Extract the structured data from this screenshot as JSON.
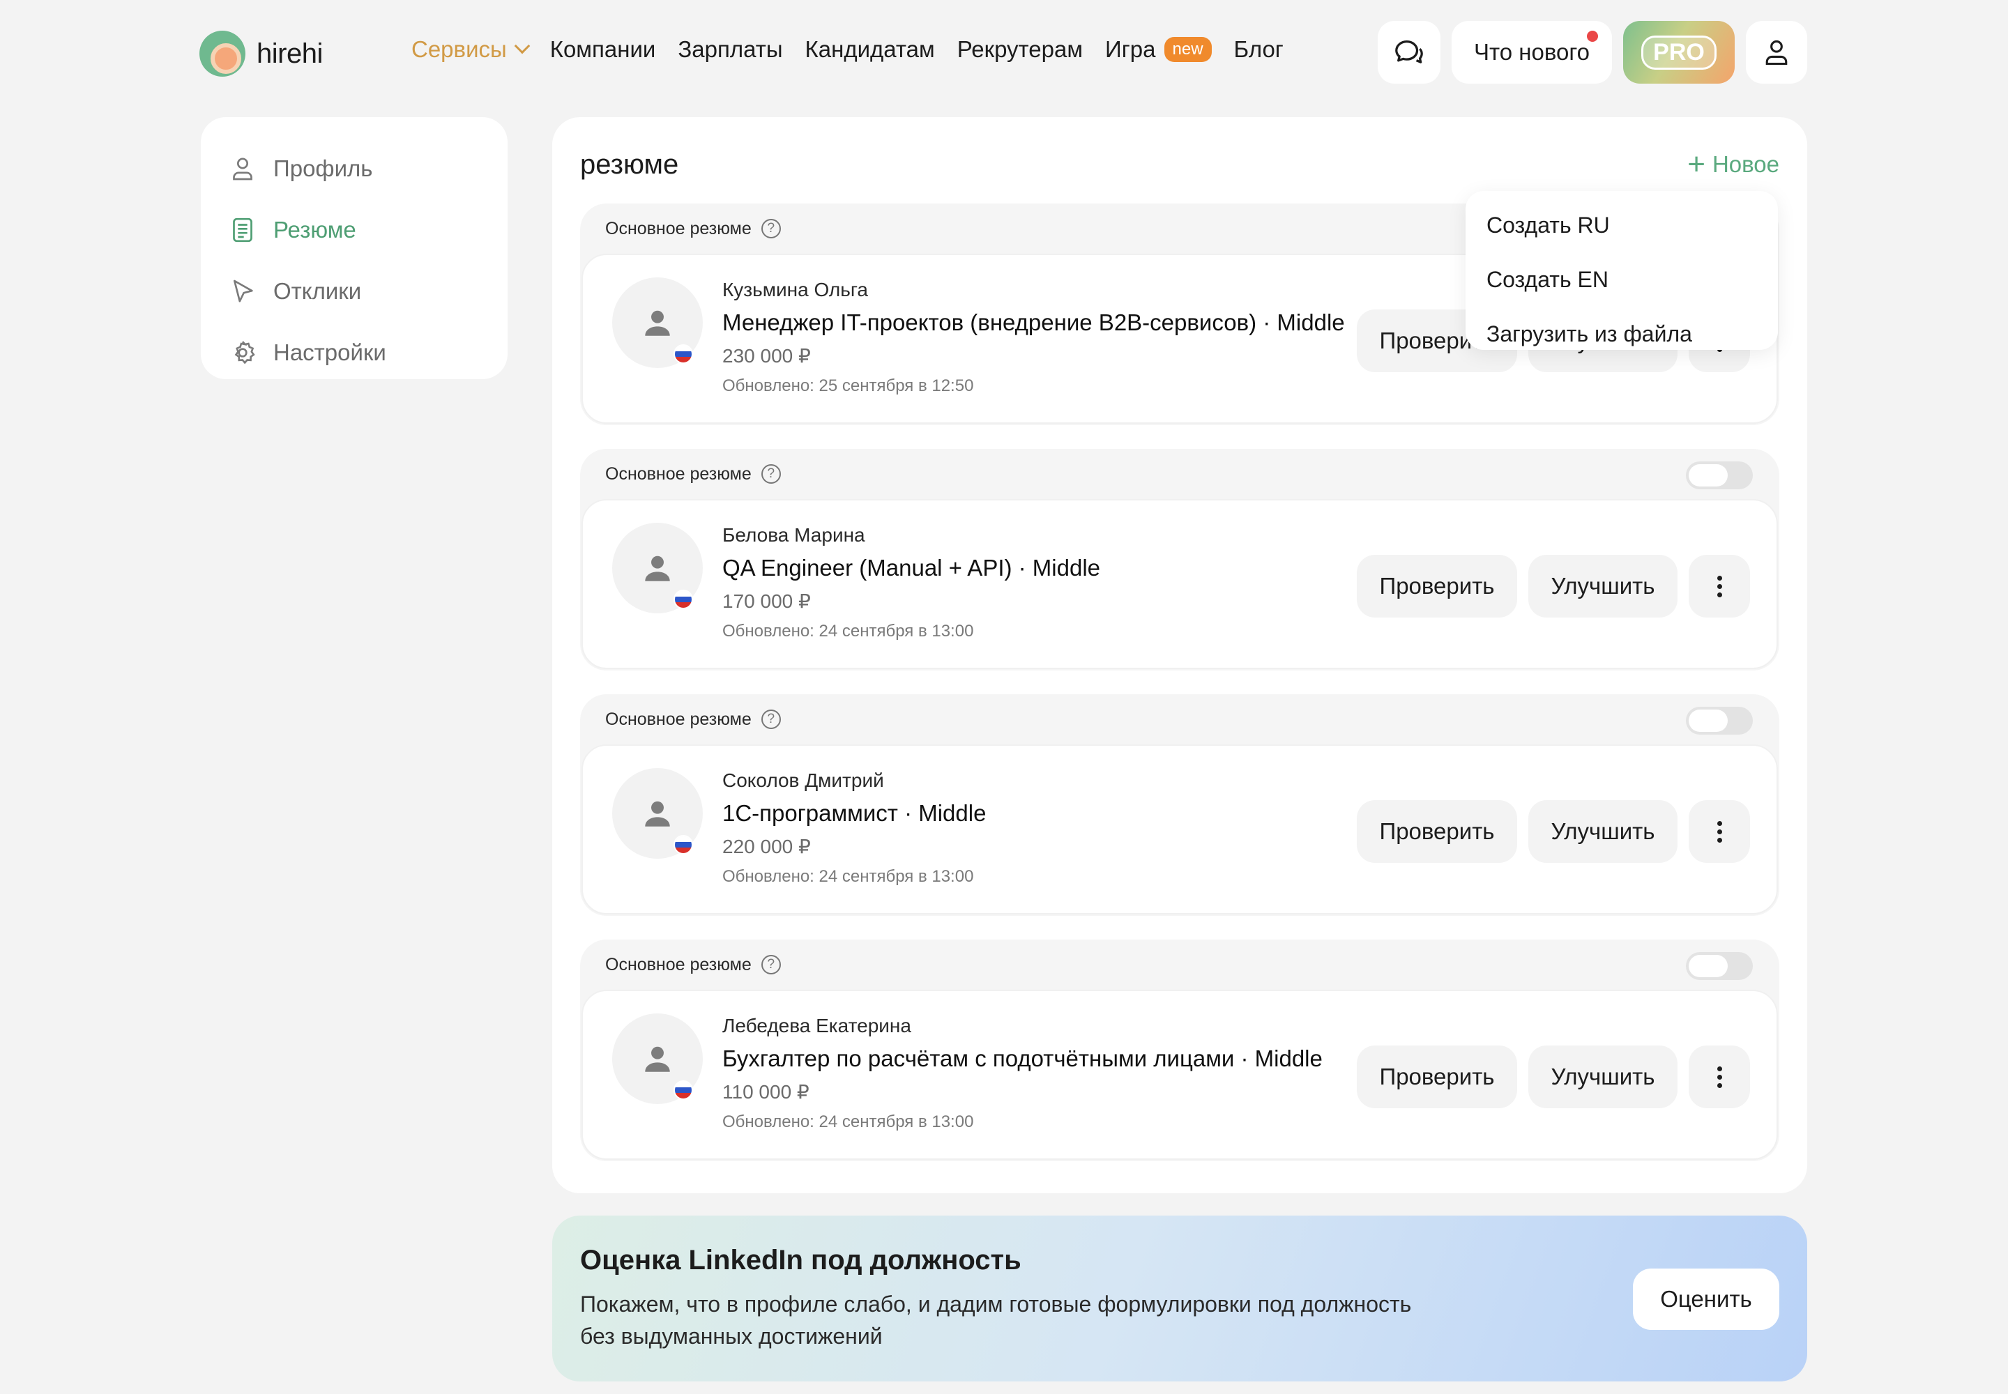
{
  "header": {
    "logo_text": "hirehi",
    "nav": [
      {
        "label": "Сервисы"
      },
      {
        "label": "Компании"
      },
      {
        "label": "Зарплаты"
      },
      {
        "label": "Кандидатам"
      },
      {
        "label": "Рекрутерам"
      },
      {
        "label": "Игра",
        "badge": "new"
      },
      {
        "label": "Блог"
      }
    ],
    "news_label": "Что нового",
    "pro_label": "PRO"
  },
  "sidebar": {
    "items": [
      {
        "label": "Профиль",
        "icon": "user-icon",
        "active": false
      },
      {
        "label": "Резюме",
        "icon": "document-icon",
        "active": true
      },
      {
        "label": "Отклики",
        "icon": "cursor-icon",
        "active": false
      },
      {
        "label": "Настройки",
        "icon": "gear-icon",
        "active": false
      }
    ]
  },
  "main": {
    "title": "резюме",
    "new_label": "Новое",
    "dropdown": [
      "Создать RU",
      "Создать EN",
      "Загрузить из файла"
    ],
    "resumes": [
      {
        "head_label": "Основное резюме",
        "name": "Кузьмина Ольга",
        "job": "Менеджер IT-проектов (внедрение B2B-сервисов) · Middle",
        "salary": "230 000 ₽",
        "updated": "Обновлено: 25 сентября в 12:50",
        "check_label": "Проверить",
        "improve_label": "Улучшить"
      },
      {
        "head_label": "Основное резюме",
        "name": "Белова Марина",
        "job": "QA Engineer (Manual + API) · Middle",
        "salary": "170 000 ₽",
        "updated": "Обновлено: 24 сентября в 13:00",
        "check_label": "Проверить",
        "improve_label": "Улучшить"
      },
      {
        "head_label": "Основное резюме",
        "name": "Соколов Дмитрий",
        "job": "1С-программист · Middle",
        "salary": "220 000 ₽",
        "updated": "Обновлено: 24 сентября в 13:00",
        "check_label": "Проверить",
        "improve_label": "Улучшить"
      },
      {
        "head_label": "Основное резюме",
        "name": "Лебедева Екатерина",
        "job": "Бухгалтер по расчётам с подотчётными лицами · Middle",
        "salary": "110 000 ₽",
        "updated": "Обновлено: 24 сентября в 13:00",
        "check_label": "Проверить",
        "improve_label": "Улучшить"
      }
    ]
  },
  "banner": {
    "title": "Оценка LinkedIn под должность",
    "text": "Покажем, что в профиле слабо, и дадим готовые формулировки под должность без выдуманных достижений",
    "button_label": "Оценить"
  },
  "colors": {
    "accent_green": "#4e9e73",
    "services_orange": "#d19a45",
    "badge_orange": "#f08a2c",
    "notify_red": "#ea4747"
  }
}
